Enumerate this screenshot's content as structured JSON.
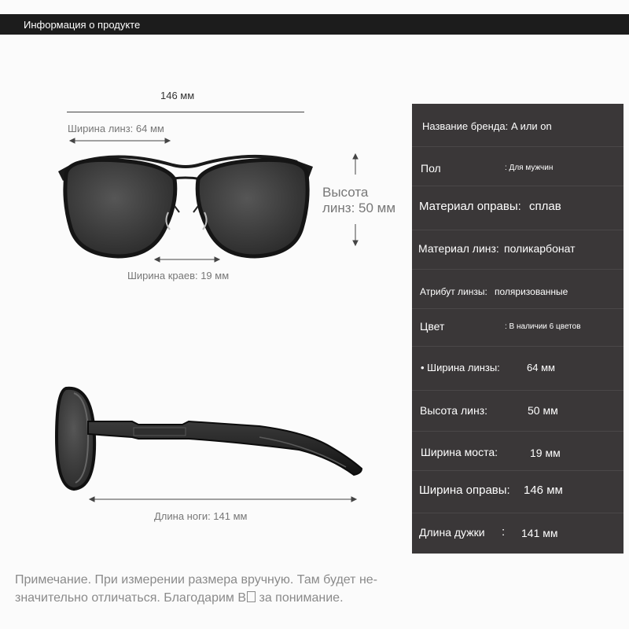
{
  "header": {
    "title": "Информация о продукте"
  },
  "dimensions": {
    "total_width": "146 мм",
    "lens_width": "Ширина линз: 64 мм",
    "lens_height_line1": "Высота",
    "lens_height_line2": "линз: 50 мм",
    "rim_width": "Ширина краев: 19 мм",
    "temple_length": "Длина ноги: 141 мм"
  },
  "specs": [
    {
      "label": "Название бренда:",
      "value": "A или on"
    },
    {
      "label": "Пол",
      "value": ": Для мужчин"
    },
    {
      "label": "Материал оправы:",
      "value": "сплав"
    },
    {
      "label": "Материал линз:",
      "value": "поликарбонат"
    },
    {
      "label": "Атрибут линзы:",
      "value": "поляризованные"
    },
    {
      "label": "Цвет",
      "value": ":   В наличии 6 цветов"
    },
    {
      "label": "• Ширина линзы:",
      "value": "64 мм"
    },
    {
      "label": "Высота линз:",
      "value": "50 мм"
    },
    {
      "label": "Ширина моста:",
      "value": "19 мм"
    },
    {
      "label": "Ширина оправы:",
      "value": "146 мм"
    },
    {
      "label": "Длина дужки",
      "value": "141 мм",
      "separator": ":"
    }
  ],
  "note": {
    "line1": "Примечание. При измерении размера вручную. Там будет не-",
    "line2": "значительно отличаться. Благодарим В",
    "line2_end": " за понимание."
  },
  "colors": {
    "panel": "#3a3738",
    "header": "#1c1c1c",
    "frame": "#1a1a1a"
  },
  "icons": [
    "glasses-front",
    "glasses-side",
    "arrow"
  ]
}
